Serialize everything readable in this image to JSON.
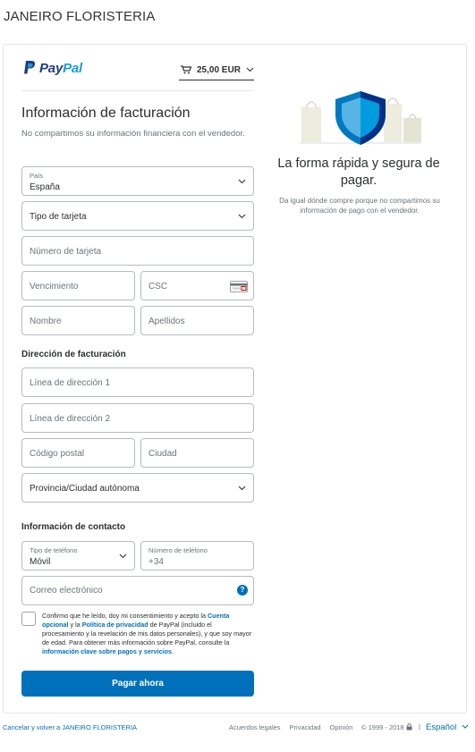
{
  "merchant_name": "JANEIRO FLORISTERIA",
  "brand": {
    "pay": "Pay",
    "pal": "Pal",
    "primary_blue": "#253b80",
    "light_blue": "#179bd7",
    "accent": "#0070ba"
  },
  "cart": {
    "icon": "cart-icon",
    "amount": "25,00 EUR"
  },
  "billing": {
    "title": "Información de facturación",
    "subtitle": "No compartimos su información financiera con el vendedor.",
    "country_label": "País",
    "country_value": "España",
    "card_type": "Tipo de tarjeta",
    "card_number": "Número de tarjeta",
    "expiry": "Vencimiento",
    "csc": "CSC",
    "first_name": "Nombre",
    "last_name": "Apellidos"
  },
  "address": {
    "title": "Dirección de facturación",
    "line1": "Línea de dirección 1",
    "line2": "Línea de dirección 2",
    "postal": "Código postal",
    "city": "Ciudad",
    "province": "Provincia/Ciudad autónoma"
  },
  "contact": {
    "title": "Información de contacto",
    "phone_type_label": "Tipo de teléfono",
    "phone_type_value": "Móvil",
    "phone_number_label": "Número de teléfono",
    "phone_prefix": "+34",
    "email": "Correo electrónico",
    "help": "?"
  },
  "consent": {
    "t1": "Confirmo que he leído, doy mi consentimiento y acepto la ",
    "l1": "Cuenta opcional",
    "t2": " y la ",
    "l2": "Política de privacidad",
    "t3": " de PayPal (incluido el procesamiento y la revelación de mis datos personales), y que soy mayor de edad. Para obtener más información sobre PayPal, consulte la ",
    "l3": "información clave sobre pagos y servicios",
    "t4": "."
  },
  "pay_button": "Pagar ahora",
  "promo": {
    "title": "La forma rápida y segura de pagar.",
    "text": "Da igual dónde compre porque no compartimos su información de pago con el vendedor."
  },
  "footer": {
    "cancel": "Cancelar y volver a JANEIRO FLORISTERIA",
    "legal": "Acuerdos legales",
    "privacy": "Privacidad",
    "feedback": "Opinión",
    "copyright": "© 1999 - 2018",
    "separator": "|",
    "language": "Español"
  }
}
